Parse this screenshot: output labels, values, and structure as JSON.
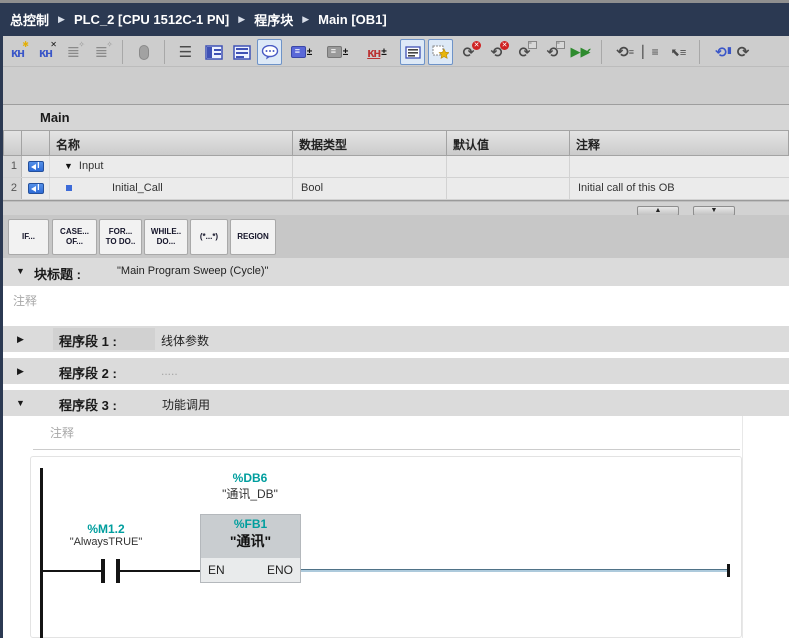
{
  "breadcrumb": {
    "separator": "▶",
    "items": [
      {
        "label": "总控制"
      },
      {
        "label": "PLC_2 [CPU 1512C-1 PN]"
      },
      {
        "label": "程序块"
      },
      {
        "label": "Main [OB1]"
      }
    ]
  },
  "toolbar": {
    "icon_names": [
      "insert-network-icon",
      "delete-network-icon",
      "auto-format-icon",
      "auto-format-options-icon",
      "drag-mode-icon",
      "outline-view-icon",
      "network-title-view-icon",
      "network-comment-view-icon",
      "toggle-comments-icon",
      "expand-boxes-icon",
      "collapse-boxes-icon",
      "absolute-symbolic-toggle-icon",
      "show-bound-operands-icon",
      "favorites-icon",
      "undo-last-error-icon",
      "redo-last-error-icon",
      "update-inconsistent-calls-icon",
      "refresh-block-calls-icon",
      "consistency-check-icon",
      "go-to-previous-icon",
      "go-to-usage-icon",
      "go-to-next-usage-icon",
      "open-block-icon",
      "close-block-icon"
    ],
    "plus_minus": "±"
  },
  "interface_area": {
    "block_name": "Main",
    "columns": [
      "名称",
      "数据类型",
      "默认值",
      "注释"
    ],
    "rows": [
      {
        "num": "1",
        "expander": "▼",
        "name": "Input",
        "datatype": "",
        "default": "",
        "comment": ""
      },
      {
        "num": "2",
        "bullet": "▪",
        "name": "Initial_Call",
        "datatype": "Bool",
        "default": "",
        "comment": "Initial call of this OB"
      }
    ],
    "scroll_up": "▲",
    "scroll_down": "▼"
  },
  "snippet_tabs": [
    {
      "line1": "IF...",
      "line2": ""
    },
    {
      "line1": "CASE...",
      "line2": "OF..."
    },
    {
      "line1": "FOR...",
      "line2": "TO DO.."
    },
    {
      "line1": "WHILE..",
      "line2": "DO..."
    },
    {
      "line1": "(*...*)",
      "line2": ""
    },
    {
      "line1": "REGION",
      "line2": ""
    }
  ],
  "block_title": {
    "arrow": "▼",
    "label": "块标题 :",
    "value": "\"Main Program Sweep (Cycle)\"",
    "comment_placeholder": "注释"
  },
  "networks": [
    {
      "arrow": "▶",
      "label": "程序段 1 :",
      "title": "线体参数"
    },
    {
      "arrow": "▶",
      "label": "程序段 2 :",
      "title": "....."
    },
    {
      "arrow": "▼",
      "label": "程序段 3 :",
      "title": "功能调用"
    }
  ],
  "network3_body": {
    "comment_placeholder": "注释",
    "contact": {
      "operand": "%M1.2",
      "symbol": "\"AlwaysTRUE\""
    },
    "instance_db": {
      "operand": "%DB6",
      "name": "\"通讯_DB\""
    },
    "fb": {
      "operand": "%FB1",
      "name": "\"通讯\"",
      "pin_in": "EN",
      "pin_out": "ENO"
    }
  },
  "colors": {
    "navy_bar": "#2b3952",
    "operand_teal": "#009e9e",
    "row_gray": "#dbdbdb",
    "toolbar_gray": "#cdcdcd",
    "power_rail": "#141414",
    "eno_wire": "#adcadc"
  }
}
